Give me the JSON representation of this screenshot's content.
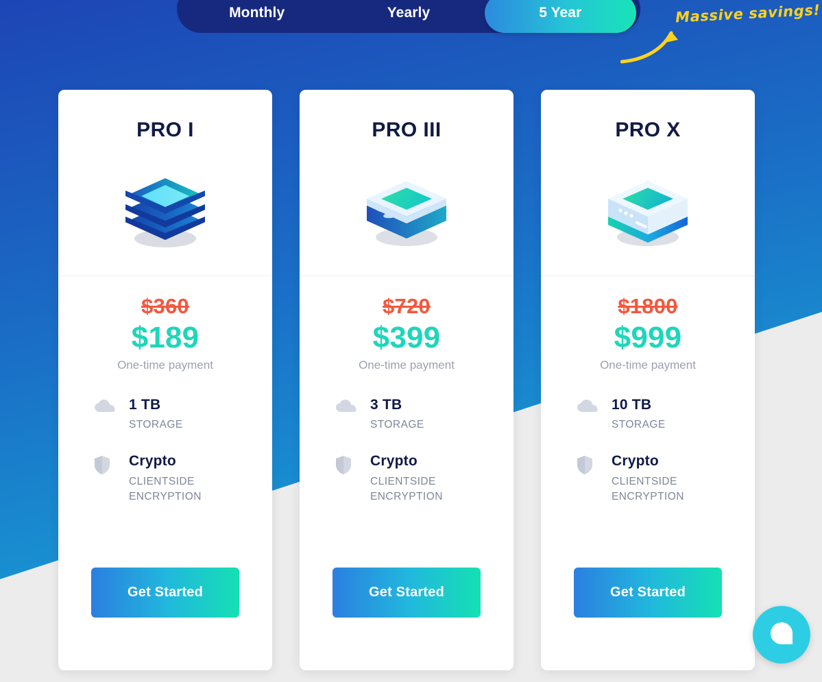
{
  "billing_toggle": {
    "options": [
      {
        "label": "Monthly",
        "active": false
      },
      {
        "label": "Yearly",
        "active": false
      },
      {
        "label": "5 Year",
        "active": true
      }
    ]
  },
  "annotation": {
    "text": "Massive savings!",
    "color": "#ffd21e",
    "arrow_icon": "curved-arrow-icon"
  },
  "plans": [
    {
      "title": "PRO I",
      "icon": "stacked-layers-icon",
      "price_old": "$360",
      "price_new": "$189",
      "price_note": "One-time payment",
      "features": [
        {
          "icon": "cloud-icon",
          "value": "1 TB",
          "label": "STORAGE"
        },
        {
          "icon": "shield-icon",
          "value": "Crypto",
          "label": "CLIENTSIDE\nENCRYPTION"
        }
      ],
      "cta_label": "Get Started"
    },
    {
      "title": "PRO III",
      "icon": "liquid-box-icon",
      "price_old": "$720",
      "price_new": "$399",
      "price_note": "One-time payment",
      "features": [
        {
          "icon": "cloud-icon",
          "value": "3 TB",
          "label": "STORAGE"
        },
        {
          "icon": "shield-icon",
          "value": "Crypto",
          "label": "CLIENTSIDE\nENCRYPTION"
        }
      ],
      "cta_label": "Get Started"
    },
    {
      "title": "PRO X",
      "icon": "server-box-icon",
      "price_old": "$1800",
      "price_new": "$999",
      "price_note": "One-time payment",
      "features": [
        {
          "icon": "cloud-icon",
          "value": "10 TB",
          "label": "STORAGE"
        },
        {
          "icon": "shield-icon",
          "value": "Crypto",
          "label": "CLIENTSIDE\nENCRYPTION"
        }
      ],
      "cta_label": "Get Started"
    }
  ],
  "chat_widget": {
    "icon": "chat-bubble-icon",
    "color": "#2dcee3"
  },
  "colors": {
    "background_blue_top": "#1d45b5",
    "background_blue_bottom": "#1b96d2",
    "toggle_track": "#17297e",
    "accent_teal": "#1ed6bb",
    "price_strike_red": "#f2583e",
    "title_navy": "#111a45",
    "muted_gray": "#9aa1b0",
    "page_gray": "#ececec"
  }
}
